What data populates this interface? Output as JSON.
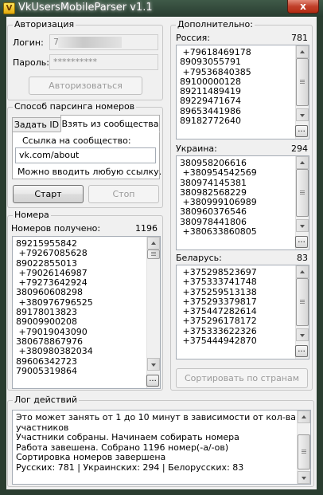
{
  "window": {
    "title": "VkUsersMobileParser v1.1",
    "icon": "app-icon",
    "close_label": "x"
  },
  "auth": {
    "group_title": "Авторизация",
    "login_label": "Логин:",
    "login_value": "7",
    "password_label": "Пароль:",
    "password_value": "**********",
    "login_button": "Авторизоваться"
  },
  "parse": {
    "group_title": "Способ парсинга номеров",
    "tabs": [
      {
        "label": "Задать ID"
      },
      {
        "label": "Взять из сообщества"
      }
    ],
    "link_label": "Ссылка на сообщество:",
    "link_value": "vk.com/about",
    "hint": "Можно вводить любую ссылку.",
    "start_button": "Старт",
    "stop_button": "Стоп"
  },
  "numbers": {
    "group_title": "Номера",
    "received_label": "Номеров получено:",
    "received_count": "1196",
    "items": [
      "89215955842",
      " +79267085628",
      "89022855013",
      " +79026146987",
      " +79273642924",
      "380960608298",
      " +380976796525",
      "89178013823",
      "89009900208",
      " +79019043090",
      "380678867976",
      " +380980382034",
      "89606342723",
      "79005319864"
    ],
    "more_label": "..."
  },
  "extra": {
    "group_title": "Дополнительно:",
    "russia": {
      "label": "Россия:",
      "count": "781",
      "items": [
        " +79618469178",
        "89093055791",
        " +79536840385",
        "89100000128",
        "89211489419",
        "89229471674",
        "89653441986",
        "89182772640"
      ]
    },
    "ukraine": {
      "label": "Украина:",
      "count": "294",
      "items": [
        "380958206616",
        " +380954542569",
        "380974145381",
        "380982568229",
        " +380999106989",
        "380960376546",
        "380978441806",
        " +380633860805"
      ]
    },
    "belarus": {
      "label": "Беларусь:",
      "count": "83",
      "items": [
        " +375298523697",
        " +375333741748",
        " +375259513138",
        " +375293379817",
        " +375447282614",
        " +375296178172",
        " +375333622326",
        " +375444942870"
      ]
    },
    "more_label": "...",
    "sort_button": "Сортировать по странам"
  },
  "log": {
    "group_title": "Лог действий",
    "lines": [
      "Это может занять от 1 до 10 минут в зависимости от кол-ва",
      "участников",
      "Участники собраны. Начинаем собирать номера",
      "Работа завешена. Собрано 1196 номер(-а/-ов)",
      "Сортировка номеров завершена",
      "Русских: 781 | Украинских: 294 | Белорусских: 83"
    ]
  }
}
